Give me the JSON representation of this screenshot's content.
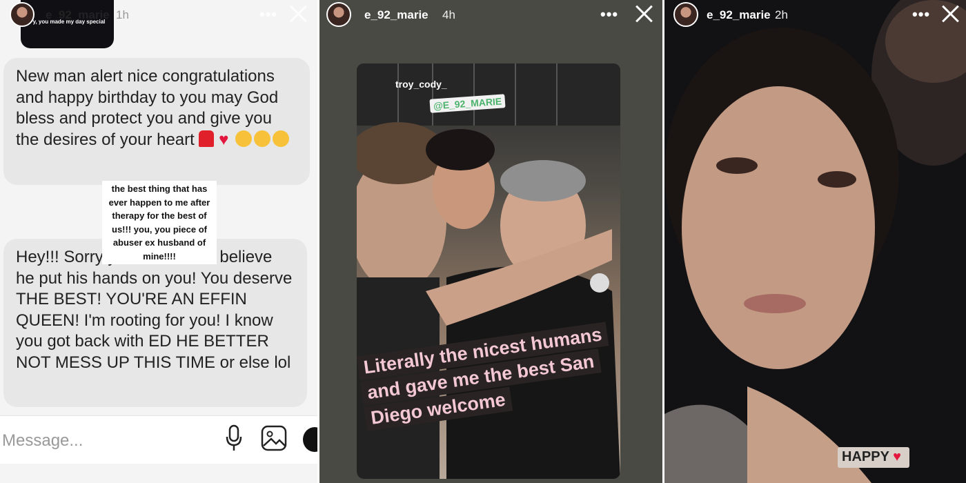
{
  "panel1": {
    "header": {
      "username": "e_92_marie",
      "time": "1h"
    },
    "thumbnail_text": "y, you made my day special",
    "bubble1": {
      "text": "New man alert nice congratulations and happy birthday to you may God bless and protect you and give you the desires of your heart"
    },
    "caption_overlay": "the best thing that has ever happen to me after therapy for the best of us!!! you, you piece of abuser ex husband of mine!!!!",
    "bubble2": {
      "text": "Hey!!! Sorry your ex! I can't believe he put his hands on you! You deserve THE BEST! YOU'RE AN EFFIN QUEEN! I'm rooting for you! I know you got back with ED HE BETTER NOT MESS UP THIS TIME or else lol"
    },
    "input": {
      "placeholder": "Message..."
    }
  },
  "panel2": {
    "header": {
      "username": "e_92_marie",
      "time": "4h"
    },
    "tags": {
      "troy": "troy_cody_",
      "marie": "@E_92_MARIE"
    },
    "caption_lines": [
      "Literally the nicest humans",
      "and gave me the best San",
      "Diego  welcome"
    ]
  },
  "panel3": {
    "header": {
      "username": "e_92_marie",
      "time": "2h"
    },
    "sticker": "HAPPY"
  },
  "icons": {
    "more": "more-icon",
    "close": "close-icon",
    "mic": "mic-icon",
    "image": "image-icon",
    "heart": "heart-icon"
  },
  "colors": {
    "bubble": "#e7e7e7",
    "caption_bg": "#2a2323",
    "caption_text": "#f3c8d4",
    "heart": "#e3163d"
  }
}
